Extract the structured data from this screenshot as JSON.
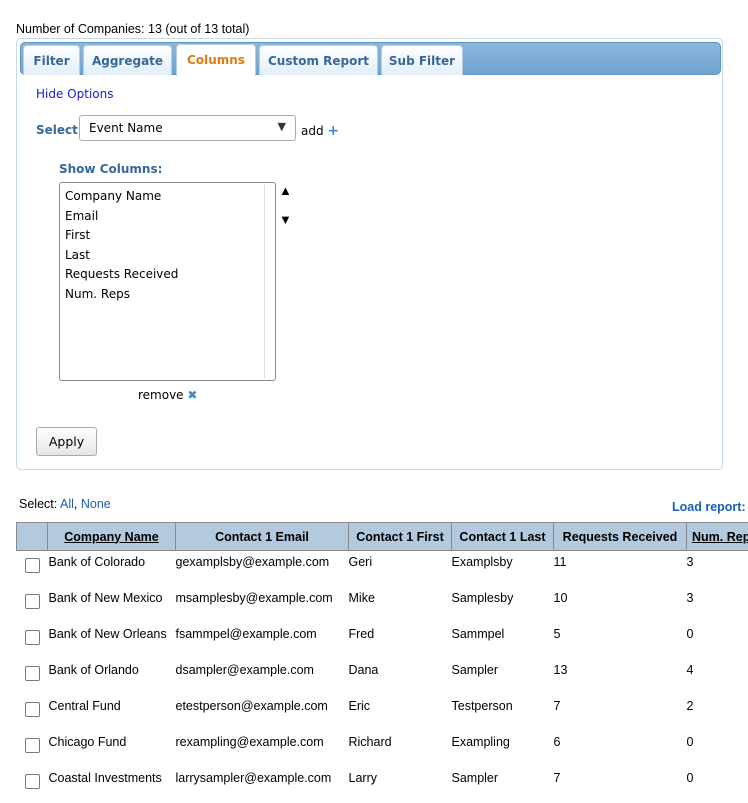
{
  "summary": "Number of Companies: 13 (out of 13 total)",
  "tabs": [
    "Filter",
    "Aggregate",
    "Columns",
    "Custom Report",
    "Sub Filter"
  ],
  "active_tab": "Columns",
  "hide_options": "Hide Options",
  "select_label": "Select:",
  "select_value": "Event Name",
  "add_label": "add",
  "show_columns_label": "Show Columns:",
  "show_columns": [
    "Company Name",
    "Email",
    "First",
    "Last",
    "Requests Received",
    "Num. Reps"
  ],
  "remove_label": "remove",
  "apply_label": "Apply",
  "select_all": {
    "prefix": "Select:",
    "all": "All",
    "none": "None"
  },
  "load_report": "Load report:",
  "table": {
    "headers": [
      "Company Name",
      "Contact 1 Email",
      "Contact 1 First",
      "Contact 1 Last",
      "Requests Received",
      "Num. Rep"
    ],
    "rows": [
      [
        "Bank of Colorado",
        "gexamplsby@example.com",
        "Geri",
        "Examplsby",
        "11",
        "3"
      ],
      [
        "Bank of New Mexico",
        "msamplesby@example.com",
        "Mike",
        "Samplesby",
        "10",
        "3"
      ],
      [
        "Bank of New Orleans",
        "fsammpel@example.com",
        "Fred",
        "Sammpel",
        "5",
        "0"
      ],
      [
        "Bank of Orlando",
        "dsampler@example.com",
        "Dana",
        "Sampler",
        "13",
        "4"
      ],
      [
        "Central Fund",
        "etestperson@example.com",
        "Eric",
        "Testperson",
        "7",
        "2"
      ],
      [
        "Chicago Fund",
        "rexampling@example.com",
        "Richard",
        "Exampling",
        "6",
        "0"
      ],
      [
        "Coastal Investments",
        "larrysampler@example.com",
        "Larry",
        "Sampler",
        "7",
        "0"
      ]
    ]
  }
}
